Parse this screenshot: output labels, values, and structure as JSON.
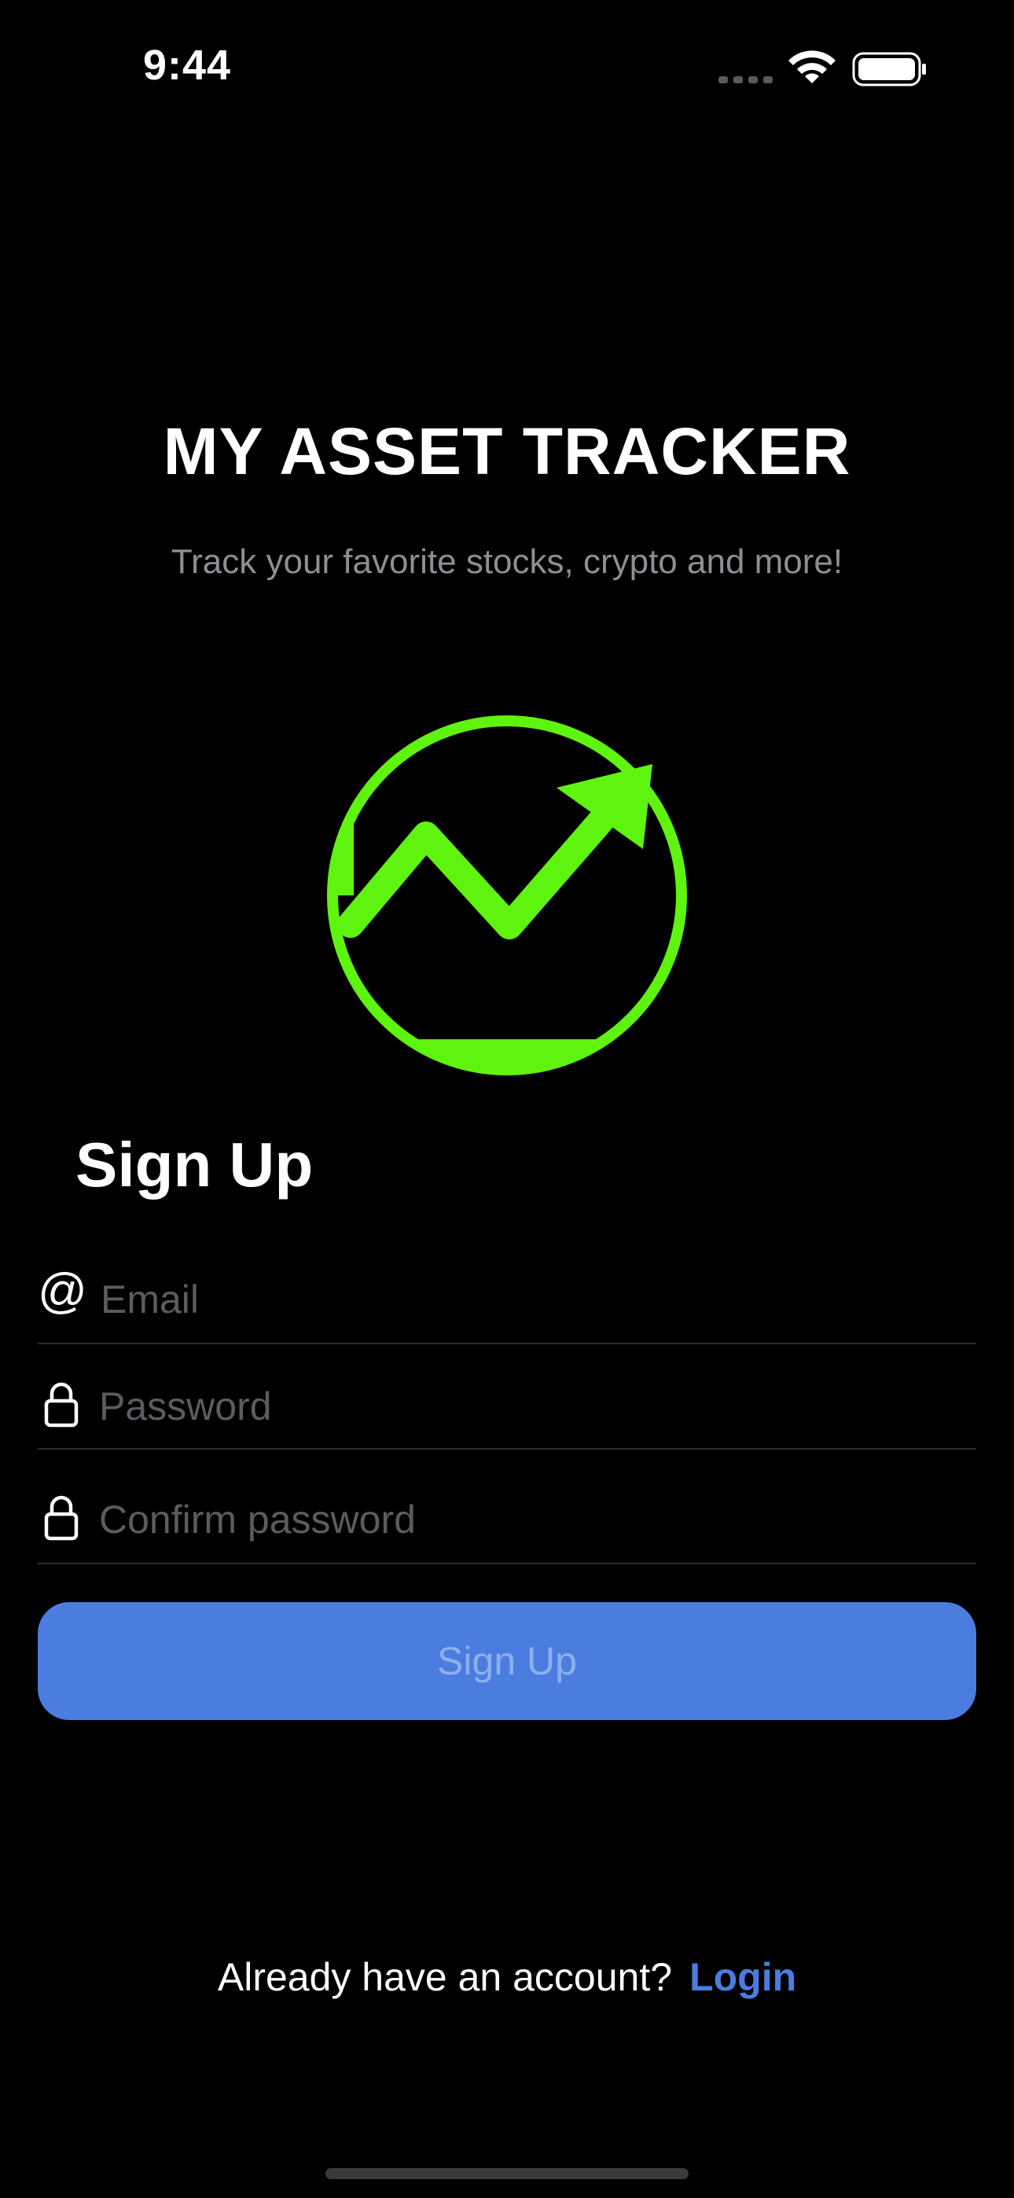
{
  "status_bar": {
    "time": "9:44"
  },
  "header": {
    "title": "MY ASSET TRACKER",
    "subtitle": "Track your favorite stocks, crypto and more!"
  },
  "logo": {
    "icon": "trending-up-chart-icon",
    "color": "#5FF40F"
  },
  "form": {
    "title": "Sign Up",
    "fields": [
      {
        "icon": "at-sign-icon",
        "value": "",
        "placeholder": "Email"
      },
      {
        "icon": "lock-icon",
        "value": "",
        "placeholder": "Password"
      },
      {
        "icon": "lock-icon",
        "value": "",
        "placeholder": "Confirm password"
      }
    ],
    "submit_label": "Sign Up",
    "submit_color": "#4A7DDF"
  },
  "footer": {
    "prompt": "Already have an account?",
    "link_label": "Login",
    "link_color": "#4A7DDF"
  }
}
